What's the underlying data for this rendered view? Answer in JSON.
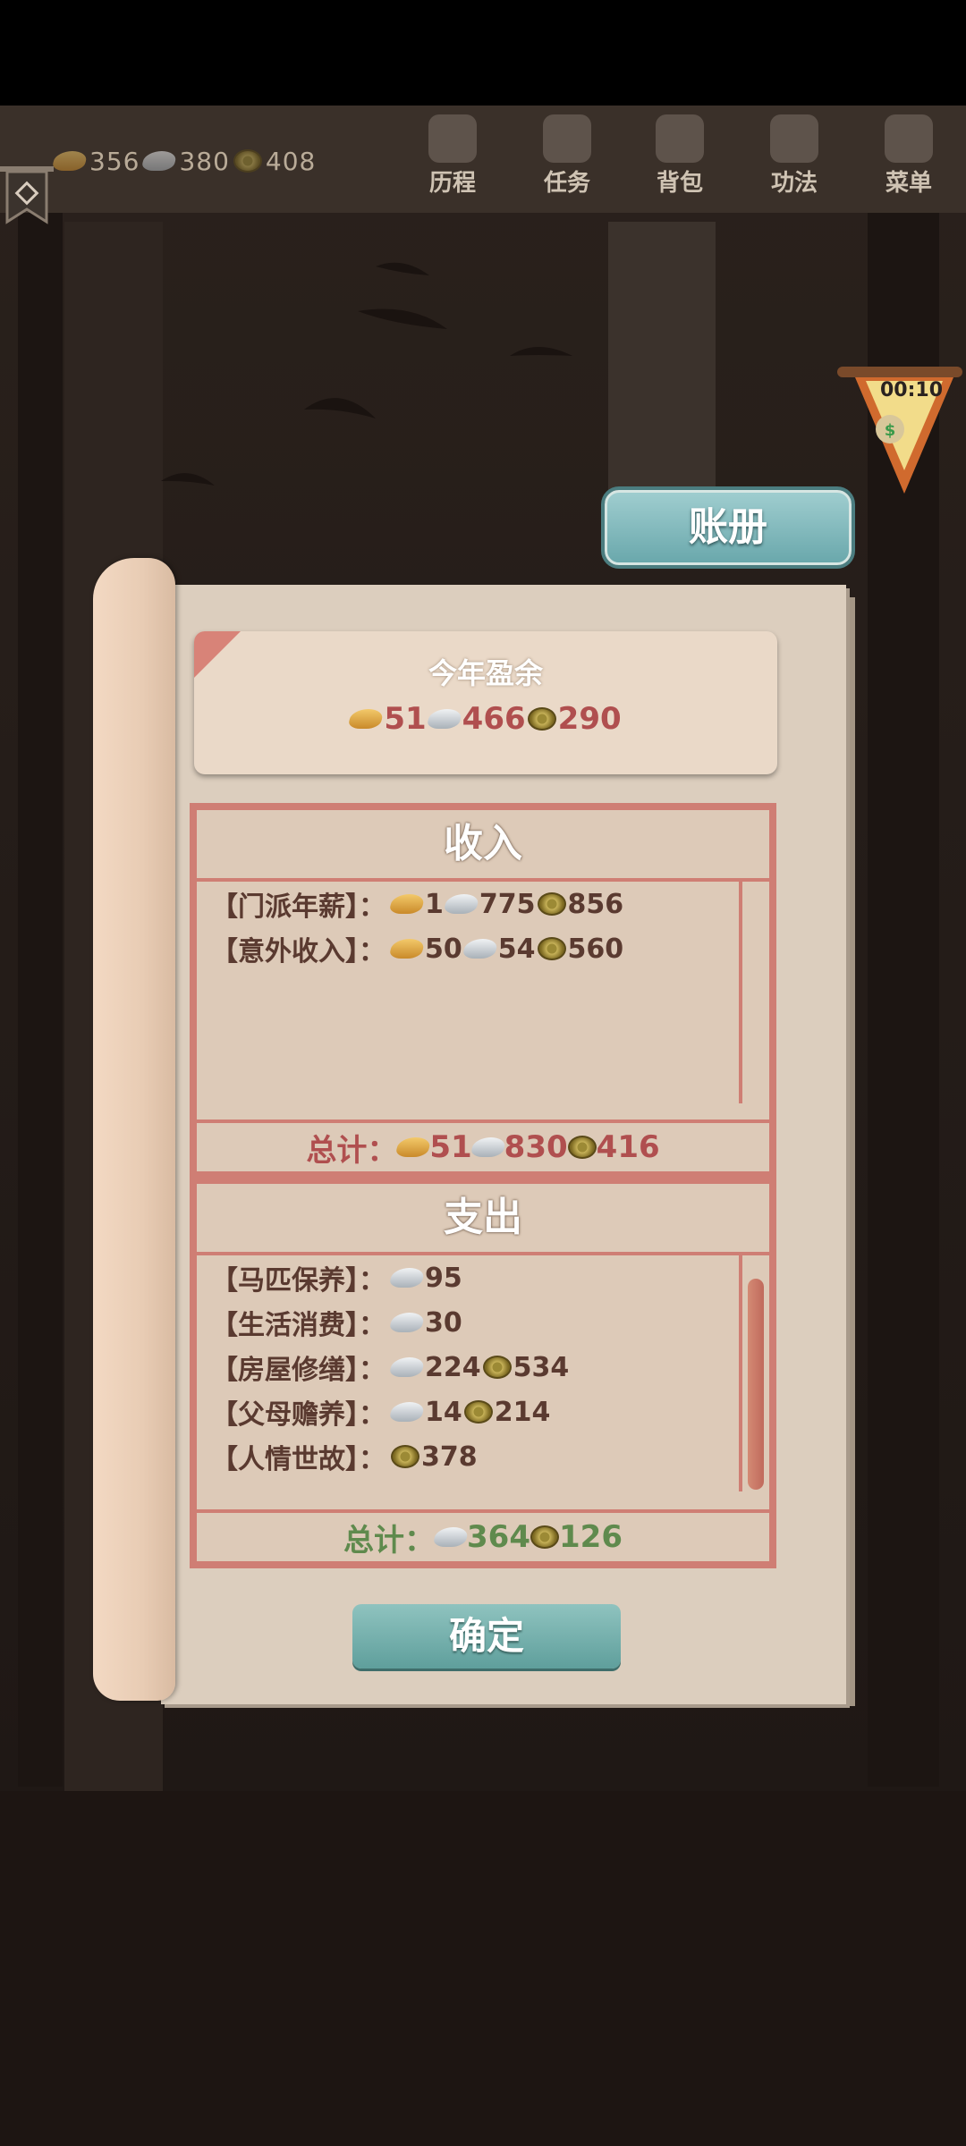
{
  "header": {
    "resources": {
      "gold": "356",
      "silver": "380",
      "copper": "408"
    },
    "nav": [
      {
        "label": "历程",
        "icon": "journey-icon"
      },
      {
        "label": "任务",
        "icon": "task-icon"
      },
      {
        "label": "背包",
        "icon": "bag-icon"
      },
      {
        "label": "功法",
        "icon": "scroll-book-icon"
      },
      {
        "label": "菜单",
        "icon": "fan-menu-icon"
      }
    ]
  },
  "timer": {
    "text": "00:10"
  },
  "ledger": {
    "title": "账册",
    "surplus": {
      "title": "今年盈余",
      "gold": "51",
      "silver": "466",
      "copper": "290"
    },
    "income": {
      "title": "收入",
      "items": [
        {
          "label": "【门派年薪】：",
          "gold": "1",
          "silver": "775",
          "copper": "856"
        },
        {
          "label": "【意外收入】：",
          "gold": "50",
          "silver": "54",
          "copper": "560"
        }
      ],
      "total_label": "总计：",
      "total": {
        "gold": "51",
        "silver": "830",
        "copper": "416"
      },
      "total_color": "#b04f4f"
    },
    "expense": {
      "title": "支出",
      "items": [
        {
          "label": "【马匹保养】：",
          "silver": "95"
        },
        {
          "label": "【生活消费】：",
          "silver": "30"
        },
        {
          "label": "【房屋修缮】：",
          "silver": "224",
          "copper": "534"
        },
        {
          "label": "【父母赡养】：",
          "silver": "14",
          "copper": "214"
        },
        {
          "label": "【人情世故】：",
          "copper": "378"
        }
      ],
      "total_label": "总计：",
      "total": {
        "silver": "364",
        "copper": "126"
      },
      "total_color": "#5f8a4d"
    },
    "confirm_label": "确定"
  },
  "colors": {
    "accent": "#cf7e74",
    "button": "#6aa8ac"
  }
}
